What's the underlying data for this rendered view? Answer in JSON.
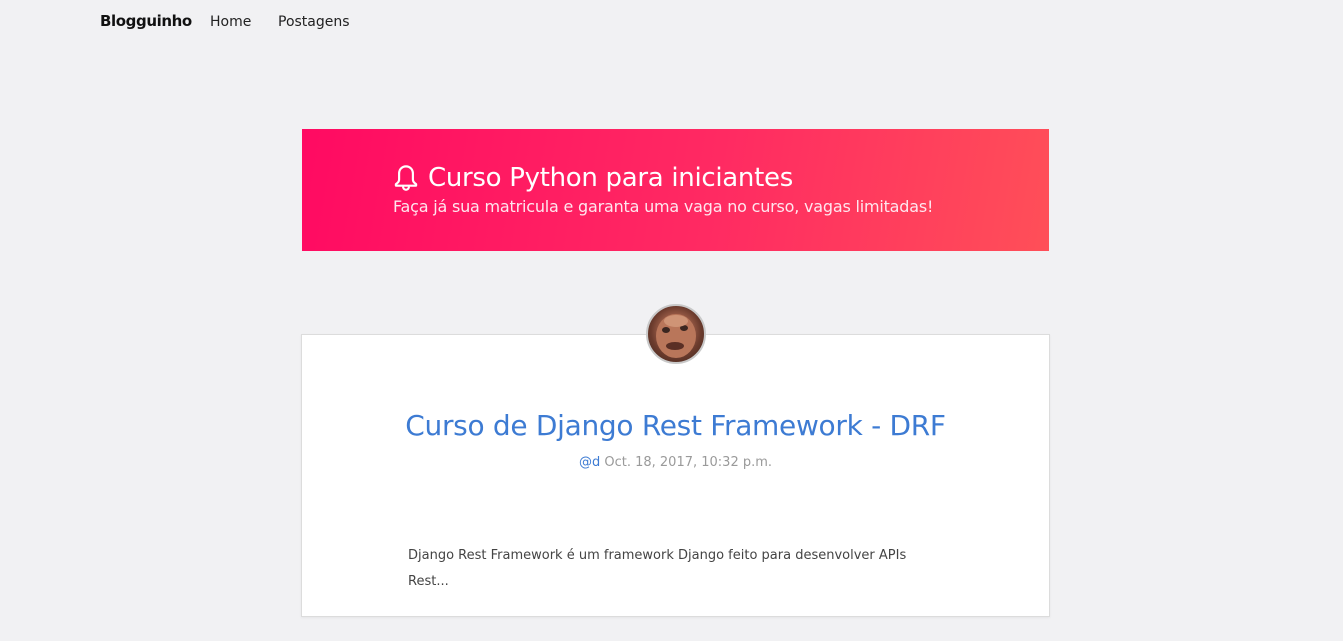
{
  "navbar": {
    "brand": "Blogguinho",
    "links": [
      "Home",
      "Postagens"
    ]
  },
  "banner": {
    "icon": "bell-icon",
    "title": "Curso Python para iniciantes",
    "subtitle": "Faça já sua matricula e garanta uma vaga no curso, vagas limitadas!"
  },
  "post": {
    "title": "Curso de Django Rest Framework - DRF",
    "author": "@d",
    "date": "Oct. 18, 2017, 10:32 p.m.",
    "excerpt": "Django Rest Framework é um framework Django feito para desenvolver APIs Rest..."
  },
  "colors": {
    "background": "#f1f1f3",
    "banner_gradient_start": "#ff0a62",
    "banner_gradient_end": "#ff4f58",
    "link_blue": "#3d7bd3"
  }
}
